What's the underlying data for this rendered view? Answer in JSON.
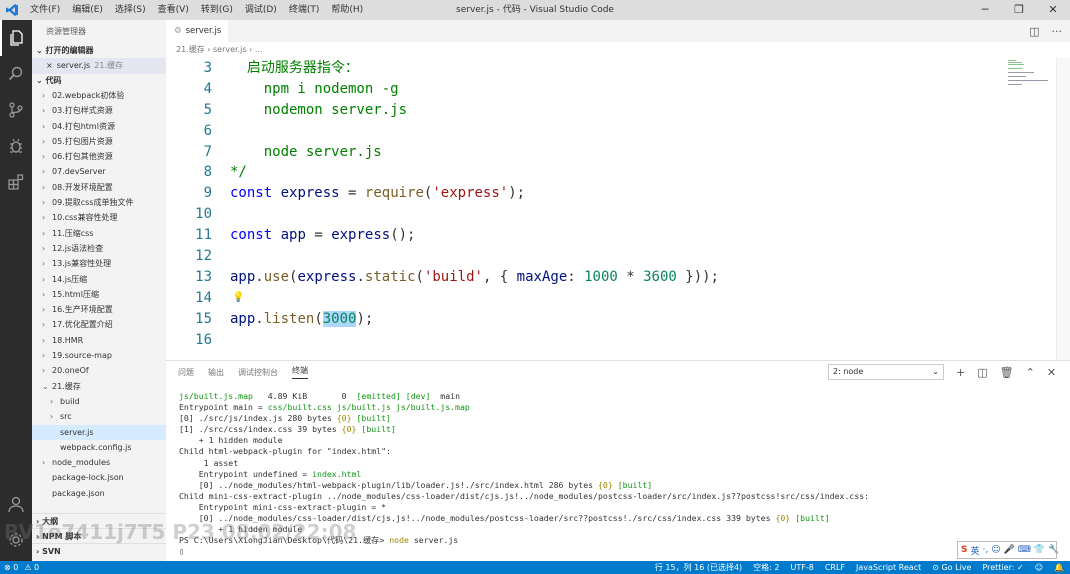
{
  "window": {
    "title": "server.js - 代码 - Visual Studio Code",
    "menu": [
      "文件(F)",
      "编辑(E)",
      "选择(S)",
      "查看(V)",
      "转到(G)",
      "调试(D)",
      "终端(T)",
      "帮助(H)"
    ],
    "controls": [
      "─",
      "❐",
      "✕"
    ]
  },
  "activity_bar": {
    "icons": [
      "files-icon",
      "search-icon",
      "source-control-icon",
      "debug-icon",
      "extensions-icon",
      "account-icon",
      "gear-icon"
    ]
  },
  "sidebar": {
    "header": "资源管理器",
    "open_editors_section": "打开的编辑器",
    "open_editor": {
      "close": "×",
      "name": "server.js",
      "path": "21.缓存"
    },
    "folder_section": "代码",
    "items": [
      {
        "label": "02.webpack初体验",
        "chevron": "›",
        "indent": 0
      },
      {
        "label": "03.打包样式资源",
        "chevron": "›",
        "indent": 0
      },
      {
        "label": "04.打包html资源",
        "chevron": "›",
        "indent": 0
      },
      {
        "label": "05.打包图片资源",
        "chevron": "›",
        "indent": 0
      },
      {
        "label": "06.打包其他资源",
        "chevron": "›",
        "indent": 0
      },
      {
        "label": "07.devServer",
        "chevron": "›",
        "indent": 0
      },
      {
        "label": "08.开发环境配置",
        "chevron": "›",
        "indent": 0
      },
      {
        "label": "09.提取css成单独文件",
        "chevron": "›",
        "indent": 0
      },
      {
        "label": "10.css兼容性处理",
        "chevron": "›",
        "indent": 0
      },
      {
        "label": "11.压缩css",
        "chevron": "›",
        "indent": 0
      },
      {
        "label": "12.js语法检查",
        "chevron": "›",
        "indent": 0
      },
      {
        "label": "13.js兼容性处理",
        "chevron": "›",
        "indent": 0
      },
      {
        "label": "14.js压缩",
        "chevron": "›",
        "indent": 0
      },
      {
        "label": "15.html压缩",
        "chevron": "›",
        "indent": 0
      },
      {
        "label": "16.生产环境配置",
        "chevron": "›",
        "indent": 0
      },
      {
        "label": "17.优化配置介绍",
        "chevron": "›",
        "indent": 0
      },
      {
        "label": "18.HMR",
        "chevron": "›",
        "indent": 0
      },
      {
        "label": "19.source-map",
        "chevron": "›",
        "indent": 0
      },
      {
        "label": "20.oneOf",
        "chevron": "›",
        "indent": 0
      },
      {
        "label": "21.缓存",
        "chevron": "⌄",
        "indent": 0
      },
      {
        "label": "build",
        "chevron": "›",
        "indent": 1
      },
      {
        "label": "src",
        "chevron": "›",
        "indent": 1
      },
      {
        "label": "server.js",
        "chevron": "",
        "indent": 1,
        "selected": true
      },
      {
        "label": "webpack.config.js",
        "chevron": "",
        "indent": 1
      },
      {
        "label": "node_modules",
        "chevron": "›",
        "indent": 0
      },
      {
        "label": "package-lock.json",
        "chevron": "",
        "indent": 0
      },
      {
        "label": "package.json",
        "chevron": "",
        "indent": 0
      }
    ],
    "bottom_sections": [
      "› 大纲",
      "› NPM 脚本",
      "› SVN"
    ]
  },
  "editor": {
    "tab": "server.js",
    "breadcrumb": "21.缓存 › server.js › ...",
    "lines": [
      {
        "n": "3",
        "text": "  启动服务器指令："
      },
      {
        "n": "4",
        "text": "    npm i nodemon -g"
      },
      {
        "n": "5",
        "text": "    nodemon server.js"
      },
      {
        "n": "6",
        "text": ""
      },
      {
        "n": "7",
        "text": "    node server.js"
      },
      {
        "n": "8",
        "text": "*/"
      },
      {
        "n": "9",
        "text": "const express = require('express');"
      },
      {
        "n": "10",
        "text": ""
      },
      {
        "n": "11",
        "text": "const app = express();"
      },
      {
        "n": "12",
        "text": ""
      },
      {
        "n": "13",
        "text": "app.use(express.static('build', { maxAge: 1000 * 3600 }));"
      },
      {
        "n": "14",
        "text": ""
      },
      {
        "n": "15",
        "text": "app.listen(3000);"
      },
      {
        "n": "16",
        "text": ""
      }
    ]
  },
  "panel": {
    "tabs": [
      "问题",
      "输出",
      "调试控制台",
      "终端"
    ],
    "active_tab": "终端",
    "terminal_select": "2: node",
    "terminal_lines": [
      "js/built.js.map   4.89 KiB       0  [emitted] [dev]  main",
      "Entrypoint main = css/built.css js/built.js js/built.js.map",
      "[0] ./src/js/index.js 280 bytes {0} [built]",
      "[1] ./src/css/index.css 39 bytes {0} [built]",
      "    + 1 hidden module",
      "Child html-webpack-plugin for \"index.html\":",
      "     1 asset",
      "    Entrypoint undefined = index.html",
      "    [0] ../node_modules/html-webpack-plugin/lib/loader.js!./src/index.html 286 bytes {0} [built]",
      "Child mini-css-extract-plugin ../node_modules/css-loader/dist/cjs.js!../node_modules/postcss-loader/src/index.js??postcss!src/css/index.css:",
      "    Entrypoint mini-css-extract-plugin = *",
      "    [0] ../node_modules/css-loader/dist/cjs.js!../node_modules/postcss-loader/src??postcss!./src/css/index.css 339 bytes {0} [built]",
      "        + 1 hidden module",
      "PS C:\\Users\\XiongJian\\Desktop\\代码\\21.缓存> node server.js",
      "▯"
    ]
  },
  "statusbar": {
    "left": [
      "⊗ 0",
      "⚠ 0"
    ],
    "right": [
      "行 15，列 16 (已选择4)",
      "空格: 2",
      "UTF-8",
      "CRLF",
      "JavaScript React",
      "⊙ Go Live",
      "Prettier: ✓",
      "☺",
      "🔔"
    ]
  },
  "ime": {
    "items": [
      "S",
      "英",
      "·,",
      "☺",
      "🎤",
      "⌨",
      "👕",
      "🔧"
    ]
  },
  "watermark": "BV1e7411j7T5 P23 08:02/22:08"
}
